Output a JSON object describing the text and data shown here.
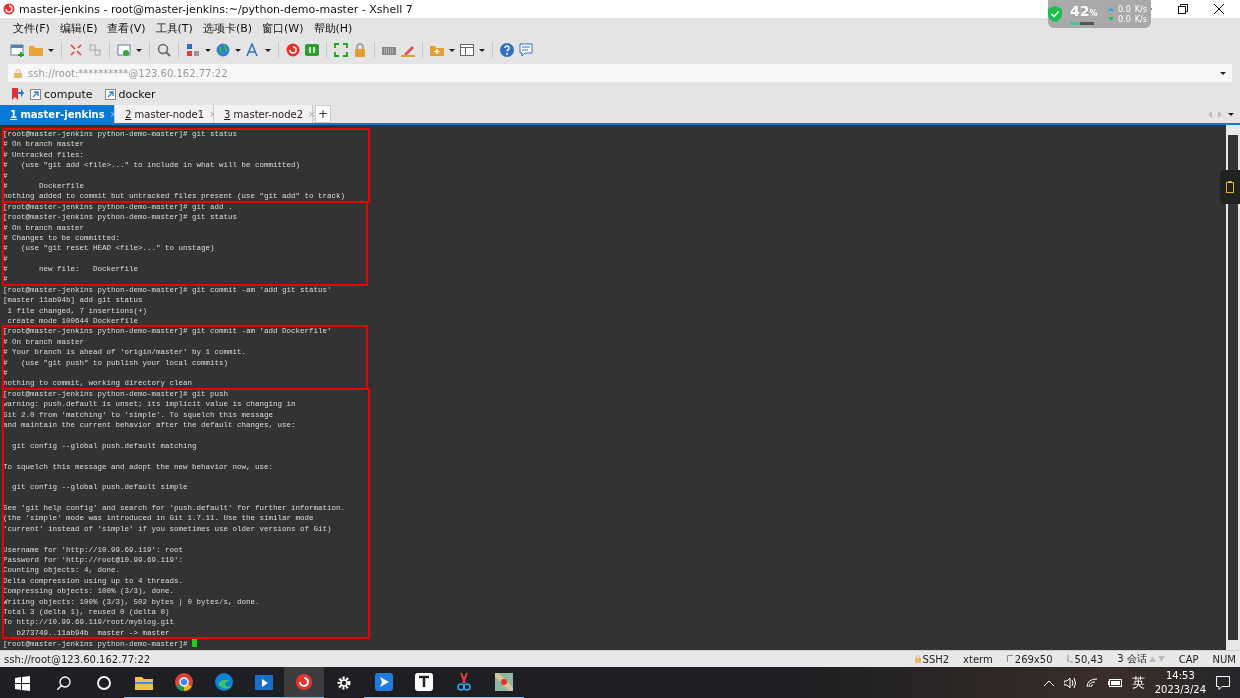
{
  "window": {
    "title": "master-jenkins - root@master-jenkins:~/python-demo-master - Xshell 7"
  },
  "net_widget": {
    "percent": "42",
    "percent_unit": "%",
    "upload": "0.0",
    "upload_unit": "K/s",
    "download": "0.0",
    "download_unit": "K/s",
    "level": 0.42
  },
  "menu": [
    "文件(F)",
    "编辑(E)",
    "查看(V)",
    "工具(T)",
    "选项卡(B)",
    "窗口(W)",
    "帮助(H)"
  ],
  "address": {
    "value": "ssh://root:**********@123.60.162.77:22"
  },
  "links": [
    "compute",
    "docker"
  ],
  "tabs": [
    {
      "number": "1",
      "label": "master-jenkins",
      "close": "×",
      "selected": true
    },
    {
      "number": "2",
      "label": "master-node1",
      "close": "×",
      "selected": false
    },
    {
      "number": "3",
      "label": "master-node2",
      "close": "×",
      "selected": false
    }
  ],
  "new_tab": "+",
  "terminal": {
    "blocks": [
      {
        "highlighted": true,
        "lines": [
          {
            "text": "[root@master-jenkins python-demo-master]# git status"
          },
          {
            "text": "# On branch master"
          },
          {
            "text": "# Untracked files:"
          },
          {
            "text": "#   (use \"git add <file>...\" to include in what will be committed)"
          },
          {
            "text": "#"
          },
          {
            "text": "#       Dockerfile"
          },
          {
            "text": "nothing added to commit but untracked files present (use \"git add\" to track)"
          }
        ]
      },
      {
        "highlighted": true,
        "lines": [
          {
            "text": "[root@master-jenkins python-demo-master]# git add ."
          },
          {
            "text": "[root@master-jenkins python-demo-master]# git status"
          },
          {
            "text": "# On branch master"
          },
          {
            "text": "# Changes to be committed:"
          },
          {
            "text": "#   (use \"git reset HEAD <file>...\" to unstage)"
          },
          {
            "text": "#"
          },
          {
            "text": "#       new file:   Dockerfile"
          },
          {
            "text": "#"
          }
        ]
      },
      {
        "highlighted": false,
        "lines": [
          {
            "text": "[root@master-jenkins python-demo-master]# git commit -am 'add git status'"
          },
          {
            "text": "[master 11ab94b] add git status"
          },
          {
            "text": " 1 file changed, 7 insertions(+)"
          },
          {
            "text": " create mode 100644 Dockerfile"
          }
        ]
      },
      {
        "highlighted": true,
        "lines": [
          {
            "text": "[root@master-jenkins python-demo-master]# git commit -am 'add Dockerfile'"
          },
          {
            "text": "# On branch master"
          },
          {
            "text": "# Your branch is ahead of 'origin/master' by 1 commit."
          },
          {
            "text": "#   (use \"git push\" to publish your local commits)"
          },
          {
            "text": "#"
          },
          {
            "text": "nothing to commit, working directory clean"
          }
        ]
      },
      {
        "highlighted": true,
        "lines": [
          {
            "text": "[root@master-jenkins python-demo-master]# git push"
          },
          {
            "text": "warning: push.default is unset; its implicit value is changing in"
          },
          {
            "text": "Git 2.0 from 'matching' to 'simple'. To squelch this message"
          },
          {
            "text": "and maintain the current behavior after the default changes, use:"
          },
          {
            "kind": "blank"
          },
          {
            "text": "  git config --global push.default matching"
          },
          {
            "kind": "blank"
          },
          {
            "text": "To squelch this message and adopt the new behavior now, use:"
          },
          {
            "kind": "blank"
          },
          {
            "text": "  git config --global push.default simple"
          },
          {
            "kind": "blank"
          },
          {
            "text": "See 'git help config' and search for 'push.default' for further information."
          },
          {
            "text": "(the 'simple' mode was introduced in Git 1.7.11. Use the similar mode"
          },
          {
            "text": "'current' instead of 'simple' if you sometimes use older versions of Git)"
          },
          {
            "kind": "blank"
          },
          {
            "text": "Username for 'http://10.99.69.119': root"
          },
          {
            "text": "Password for 'http://root@10.99.69.119':"
          },
          {
            "text": "Counting objects: 4, done."
          },
          {
            "text": "Delta compression using up to 4 threads."
          },
          {
            "text": "Compressing objects: 100% (3/3), done."
          },
          {
            "text": "Writing objects: 100% (3/3), 502 bytes | 0 bytes/s, done."
          },
          {
            "text": "Total 3 (delta 1), reused 0 (delta 0)"
          },
          {
            "text": "To http://10.99.69.119/root/myblog.git"
          },
          {
            "text": "   b273749..11ab94b  master -> master"
          }
        ]
      },
      {
        "highlighted": false,
        "lines": [
          {
            "text": "[root@master-jenkins python-demo-master]# ",
            "cursor": true
          }
        ]
      }
    ]
  },
  "status_bar": {
    "left": "ssh://root@123.60.162.77:22",
    "items": [
      "SSH2",
      "xterm",
      "269x50",
      "50,43",
      "3 会话",
      "CAP",
      "NUM"
    ]
  },
  "taskbar": {
    "ime": "英",
    "time": "14:53",
    "date": "2023/3/24"
  }
}
